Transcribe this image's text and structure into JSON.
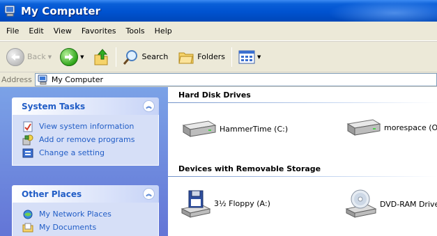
{
  "window": {
    "title": "My Computer",
    "icon": "my-computer-icon"
  },
  "menubar": {
    "items": [
      "File",
      "Edit",
      "View",
      "Favorites",
      "Tools",
      "Help"
    ]
  },
  "toolbar": {
    "back_label": "Back",
    "search_label": "Search",
    "folders_label": "Folders"
  },
  "address": {
    "label": "Address",
    "value": "My Computer"
  },
  "taskpane": {
    "system_tasks": {
      "title": "System Tasks",
      "items": [
        "View system information",
        "Add or remove programs",
        "Change a setting"
      ]
    },
    "other_places": {
      "title": "Other Places",
      "items": [
        "My Network Places",
        "My Documents"
      ]
    }
  },
  "content": {
    "hard_disks": {
      "heading": "Hard Disk Drives",
      "items": [
        "HammerTime (C:)",
        "morespace (O:"
      ]
    },
    "removable": {
      "heading": "Devices with Removable Storage",
      "items": [
        "3½ Floppy (A:)",
        "DVD-RAM Drive"
      ]
    }
  },
  "colors": {
    "titlebar": "#0054e3",
    "taskpane_link": "#215dc6",
    "taskpane_bg": "#7ba2e7"
  }
}
